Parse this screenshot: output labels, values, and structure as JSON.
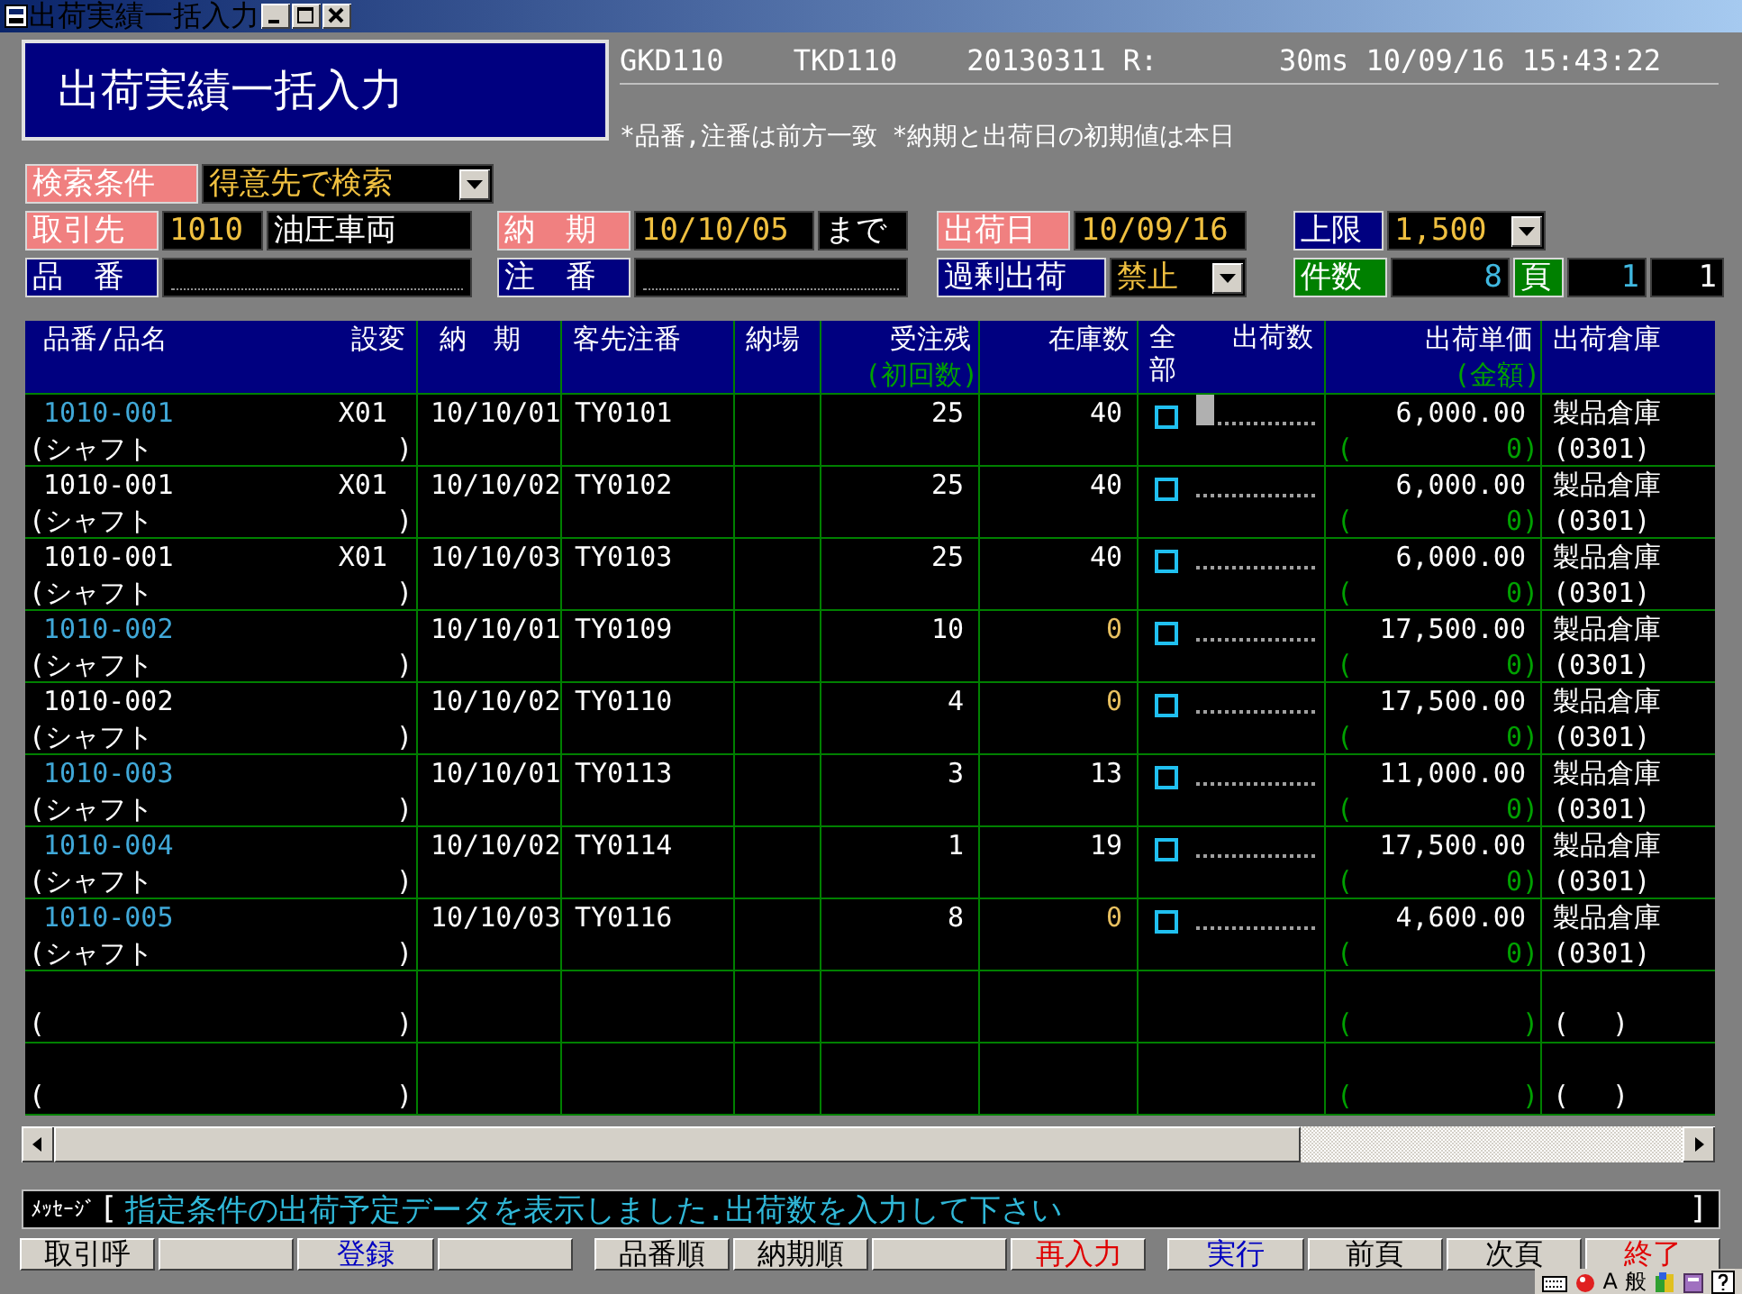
{
  "window": {
    "title": "出荷実績一括入力"
  },
  "header": {
    "title": "出荷実績一括入力",
    "info": "GKD110    TKD110    20130311 R:       30ms 10/09/16 15:43:22",
    "note": "*品番,注番は前方一致 *納期と出荷日の初期値は本日"
  },
  "filters": [
    [
      {
        "kind": "label",
        "text": "検索条件",
        "color": "#f08080"
      },
      {
        "kind": "select",
        "text": "得意先で検索"
      }
    ],
    [
      {
        "kind": "label",
        "text": "取引先",
        "color": "#f08080"
      },
      {
        "kind": "input",
        "text": "1010"
      },
      {
        "kind": "value",
        "text": "油圧車両"
      },
      {
        "kind": "label",
        "text": "納　期",
        "color": "#f08080"
      },
      {
        "kind": "input",
        "text": "10/10/05"
      },
      {
        "kind": "value",
        "text": "まで"
      },
      {
        "kind": "label",
        "text": "出荷日",
        "color": "#f08080"
      },
      {
        "kind": "input",
        "text": "10/09/16"
      },
      {
        "kind": "label",
        "text": "上限",
        "color": "#000080"
      },
      {
        "kind": "select",
        "text": "1,500"
      }
    ],
    [
      {
        "kind": "label",
        "text": "品　番",
        "color": "#000080"
      },
      {
        "kind": "empty"
      },
      {
        "kind": "label",
        "text": "注　番",
        "color": "#000080"
      },
      {
        "kind": "empty"
      },
      {
        "kind": "label",
        "text": "過剰出荷",
        "color": "#000080"
      },
      {
        "kind": "select",
        "text": "禁止"
      },
      {
        "kind": "label",
        "text": "件数",
        "color": "#008000"
      },
      {
        "kind": "count",
        "text": "8"
      },
      {
        "kind": "label",
        "text": "頁",
        "color": "#008000"
      },
      {
        "kind": "count",
        "text": "1"
      },
      {
        "kind": "value",
        "text": "1"
      }
    ]
  ],
  "columns": [
    {
      "label": "品番/品名"
    },
    {
      "label": "設変"
    },
    {
      "label": "納　期"
    },
    {
      "label": "客先注番"
    },
    {
      "label": "納場"
    },
    {
      "label": "受注残",
      "sublabel": "(初回数)"
    },
    {
      "label": "在庫数"
    },
    {
      "label": "全部"
    },
    {
      "label": "出荷数"
    },
    {
      "label": "出荷単価",
      "sublabel": "(金額)"
    },
    {
      "label": "出荷倉庫"
    }
  ],
  "rows": [
    {
      "part": "1010-001",
      "new_part": true,
      "eco": "X01",
      "name": "(シャフト",
      "name_close": ")",
      "due": "10/10/01",
      "order": "TY0101",
      "backlog": "25",
      "stock": "40",
      "out_of_stock": false,
      "checked": false,
      "qty_focused": true,
      "price": "6,000.00",
      "amount_open": "(",
      "amount": "0)",
      "warehouse": "製品倉庫",
      "warehouse_code": "(0301)"
    },
    {
      "part": "1010-001",
      "new_part": false,
      "eco": "X01",
      "name": "(シャフト",
      "name_close": ")",
      "due": "10/10/02",
      "order": "TY0102",
      "backlog": "25",
      "stock": "40",
      "out_of_stock": false,
      "checked": false,
      "qty_focused": false,
      "price": "6,000.00",
      "amount_open": "(",
      "amount": "0)",
      "warehouse": "製品倉庫",
      "warehouse_code": "(0301)"
    },
    {
      "part": "1010-001",
      "new_part": false,
      "eco": "X01",
      "name": "(シャフト",
      "name_close": ")",
      "due": "10/10/03",
      "order": "TY0103",
      "backlog": "25",
      "stock": "40",
      "out_of_stock": false,
      "checked": false,
      "qty_focused": false,
      "price": "6,000.00",
      "amount_open": "(",
      "amount": "0)",
      "warehouse": "製品倉庫",
      "warehouse_code": "(0301)"
    },
    {
      "part": "1010-002",
      "new_part": true,
      "name": "(シャフト",
      "name_close": ")",
      "due": "10/10/01",
      "order": "TY0109",
      "backlog": "10",
      "stock": "0",
      "out_of_stock": true,
      "checked": false,
      "qty_focused": false,
      "price": "17,500.00",
      "amount_open": "(",
      "amount": "0)",
      "warehouse": "製品倉庫",
      "warehouse_code": "(0301)"
    },
    {
      "part": "1010-002",
      "new_part": false,
      "name": "(シャフト",
      "name_close": ")",
      "due": "10/10/02",
      "order": "TY0110",
      "backlog": "4",
      "stock": "0",
      "out_of_stock": true,
      "checked": false,
      "qty_focused": false,
      "price": "17,500.00",
      "amount_open": "(",
      "amount": "0)",
      "warehouse": "製品倉庫",
      "warehouse_code": "(0301)"
    },
    {
      "part": "1010-003",
      "new_part": true,
      "name": "(シャフト",
      "name_close": ")",
      "due": "10/10/01",
      "order": "TY0113",
      "backlog": "3",
      "stock": "13",
      "out_of_stock": false,
      "checked": false,
      "qty_focused": false,
      "price": "11,000.00",
      "amount_open": "(",
      "amount": "0)",
      "warehouse": "製品倉庫",
      "warehouse_code": "(0301)"
    },
    {
      "part": "1010-004",
      "new_part": true,
      "name": "(シャフト",
      "name_close": ")",
      "due": "10/10/02",
      "order": "TY0114",
      "backlog": "1",
      "stock": "19",
      "out_of_stock": false,
      "checked": false,
      "qty_focused": false,
      "price": "17,500.00",
      "amount_open": "(",
      "amount": "0)",
      "warehouse": "製品倉庫",
      "warehouse_code": "(0301)"
    },
    {
      "part": "1010-005",
      "new_part": true,
      "name": "(シャフト",
      "name_close": ")",
      "due": "10/10/03",
      "order": "TY0116",
      "backlog": "8",
      "stock": "0",
      "out_of_stock": true,
      "checked": false,
      "qty_focused": false,
      "price": "4,600.00",
      "amount_open": "(",
      "amount": "0)",
      "warehouse": "製品倉庫",
      "warehouse_code": "(0301)"
    },
    {
      "name": "(",
      "name_close": ")",
      "amount_open": "(",
      "amount": ")",
      "warehouse_code": "(　 )"
    },
    {
      "name": "(",
      "name_close": ")",
      "amount_open": "(",
      "amount": ")",
      "warehouse_code": "(　 )"
    }
  ],
  "message": {
    "label": "ﾒｯｾｰｼﾞ",
    "open": "[",
    "text": "指定条件の出荷予定データを表示しました.出荷数を入力して下さい",
    "close": "]"
  },
  "function_keys": [
    {
      "kind": "key",
      "label": "取引呼"
    },
    {
      "kind": "blank"
    },
    {
      "kind": "commit",
      "label": "登録"
    },
    {
      "kind": "blank"
    },
    {
      "kind": "key",
      "label": "品番順"
    },
    {
      "kind": "key",
      "label": "納期順"
    },
    {
      "kind": "blank"
    },
    {
      "kind": "reset",
      "label": "再入力"
    },
    {
      "kind": "commit",
      "label": "実行"
    },
    {
      "kind": "key",
      "label": "前頁"
    },
    {
      "kind": "key",
      "label": "次頁"
    },
    {
      "kind": "reset",
      "label": "終了"
    }
  ],
  "ime_bar": {
    "mode": "A",
    "dictionary": "般"
  }
}
